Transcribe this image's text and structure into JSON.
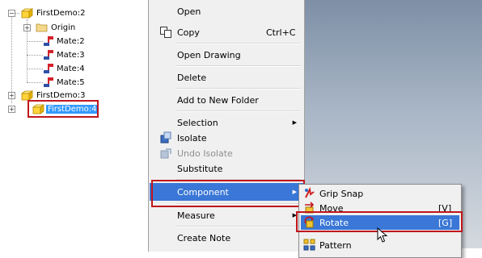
{
  "tree": {
    "nodes": [
      {
        "label": "FirstDemo:2"
      },
      {
        "label": "Origin"
      },
      {
        "label": "Mate:2"
      },
      {
        "label": "Mate:3"
      },
      {
        "label": "Mate:4"
      },
      {
        "label": "Mate:5"
      },
      {
        "label": "FirstDemo:3"
      },
      {
        "label": "FirstDemo:4"
      }
    ],
    "expander_plus": "+",
    "expander_minus": "−"
  },
  "menu": {
    "open": "Open",
    "copy": "Copy",
    "copy_shortcut": "Ctrl+C",
    "open_drawing": "Open Drawing",
    "delete": "Delete",
    "add_to_new_folder": "Add to New Folder",
    "selection": "Selection",
    "isolate": "Isolate",
    "undo_isolate": "Undo Isolate",
    "substitute": "Substitute",
    "component": "Component",
    "measure": "Measure",
    "create_note": "Create Note"
  },
  "submenu": {
    "grip_snap": "Grip Snap",
    "move": "Move",
    "move_shortcut": "[V]",
    "rotate": "Rotate",
    "rotate_shortcut": "[G]",
    "pattern": "Pattern"
  },
  "colors": {
    "highlight": "#3a77d6",
    "selection": "#3399ff",
    "annotation_box": "#c0161c"
  }
}
